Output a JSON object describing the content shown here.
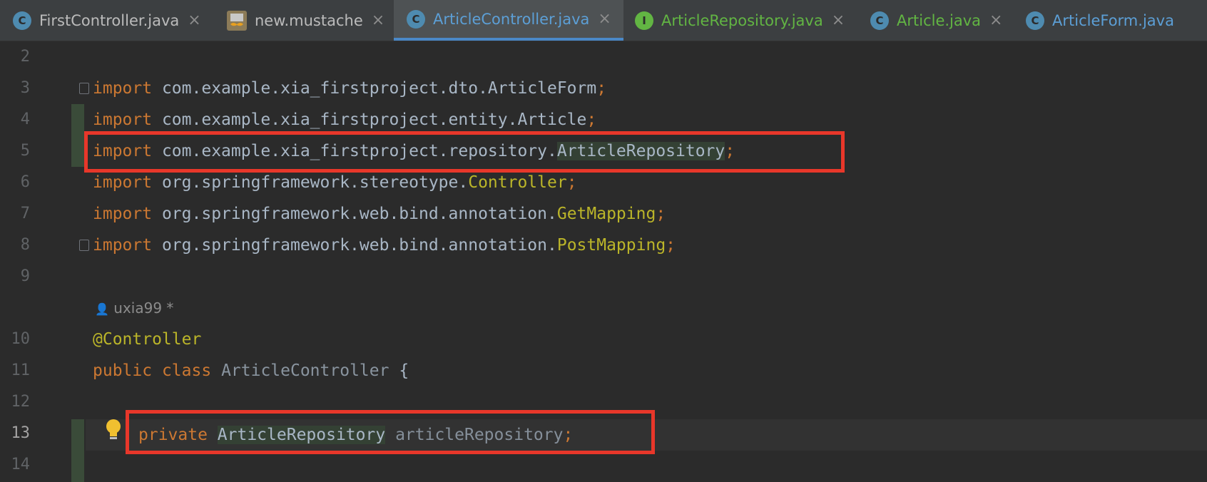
{
  "tabs": [
    {
      "label": "FirstController.java",
      "icon": "C",
      "type": "class"
    },
    {
      "label": "new.mustache",
      "icon": "",
      "type": "mustache"
    },
    {
      "label": "ArticleController.java",
      "icon": "C",
      "type": "class",
      "active": true
    },
    {
      "label": "ArticleRepository.java",
      "icon": "I",
      "type": "interface"
    },
    {
      "label": "Article.java",
      "icon": "C",
      "type": "class"
    },
    {
      "label": "ArticleForm.java",
      "icon": "C",
      "type": "class"
    }
  ],
  "close_glyph": "×",
  "lines": {
    "n2": "2",
    "n3": "3",
    "n4": "4",
    "n5": "5",
    "n6": "6",
    "n7": "7",
    "n8": "8",
    "n9": "9",
    "n10": "10",
    "n11": "11",
    "n12": "12",
    "n13": "13",
    "n14": "14"
  },
  "code": {
    "import_kw": "import",
    "l3_pkg": "com.example.xia_firstproject.dto.ArticleForm",
    "l4_pkg": "com.example.xia_firstproject.entity.Article",
    "l5_pkg": "com.example.xia_firstproject.repository.",
    "l5_cls": "ArticleRepository",
    "l6_pkg": "org.springframework.stereotype.",
    "l6_cls": "Controller",
    "l7_pkg": "org.springframework.web.bind.annotation.",
    "l7_cls": "GetMapping",
    "l8_pkg": "org.springframework.web.bind.annotation.",
    "l8_cls": "PostMapping",
    "semi": ";",
    "author": "uxia99 *",
    "annotation": "@Controller",
    "public_kw": "public",
    "class_kw": "class",
    "class_name": "ArticleController",
    "brace": "{",
    "private_kw": "private",
    "field_type": "ArticleRepository",
    "field_name": "articleRepository"
  },
  "colors": {
    "keyword": "#cc7832",
    "annotation": "#bbb529",
    "highlight_box": "#e8372a",
    "active_tab_underline": "#4a88c7"
  }
}
